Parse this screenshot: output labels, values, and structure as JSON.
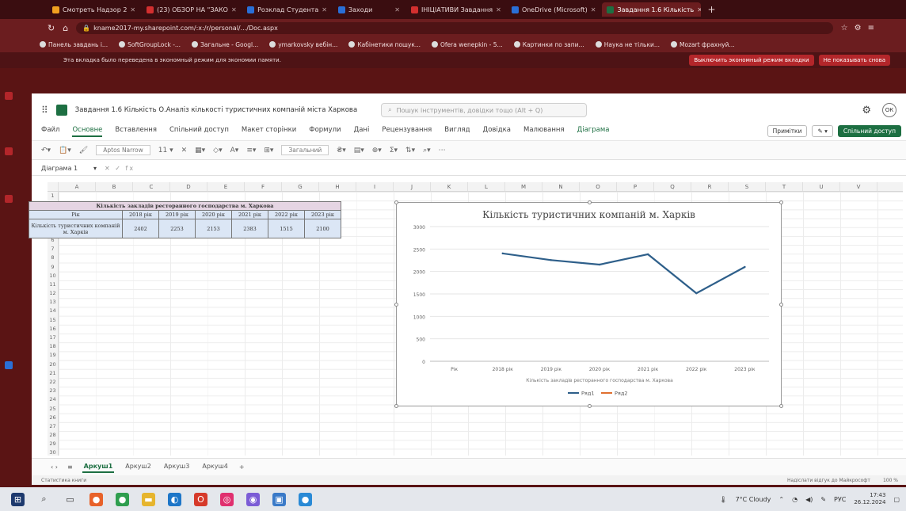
{
  "browser": {
    "tabs": [
      {
        "label": "Смотреть Надзор 2"
      },
      {
        "label": "(23) ОБЗОР НА \"ЗАКО"
      },
      {
        "label": "Розклад Студента"
      },
      {
        "label": "Заходи"
      },
      {
        "label": "ІНІЦІАТИВИ Завдання"
      },
      {
        "label": "OneDrive (Microsoft)"
      },
      {
        "label": "Завдання 1.6 Кількість",
        "active": true
      }
    ],
    "url": "kname2017-my.sharepoint.com/:x:/r/personal/.../Doc.aspx",
    "bookmarks": [
      "Панель завдань і...",
      "SoftGroupLock -...",
      "Загальне - Googl...",
      "ymarkovsky вебін...",
      "Кабінетики пошук...",
      "Ofera wenepkin - 5...",
      "Картинки по запи...",
      "Наука не тільки...",
      "Mozart фрахнуй..."
    ],
    "infobar": {
      "message": "Эта вкладка было переведена в экономный режим для экономии памяти.",
      "primary_button": "Выключить экономный режим вкладки",
      "secondary_button": "Не показывать снова"
    }
  },
  "excel": {
    "title": "Завдання 1.6 Кількість О.Аналіз кількості туристичних компаній міста Харкова",
    "search_placeholder": "Пошук інструментів, довідки тощо (Alt + Q)",
    "user_initials": "ОК",
    "menu": [
      "Файл",
      "Основне",
      "Вставлення",
      "Спільний доступ",
      "Макет сторінки",
      "Формули",
      "Дані",
      "Рецензування",
      "Вигляд",
      "Довідка",
      "Малювання",
      "Діаграма"
    ],
    "active_menu": "Основне",
    "accent_menu": "Діаграма",
    "comments_label": "Примітки",
    "share_label": "Спільний доступ",
    "font_name": "Aptos Narrow",
    "number_format": "Загальний",
    "namebox": "Діаграма 1",
    "columns": [
      "A",
      "B",
      "C",
      "D",
      "E",
      "F",
      "G",
      "H",
      "I",
      "J",
      "K",
      "L",
      "M",
      "N",
      "O",
      "P",
      "Q",
      "R",
      "S",
      "T",
      "U",
      "V"
    ],
    "rows": [
      "1",
      "2",
      "3",
      "4",
      "5",
      "6",
      "7",
      "8",
      "9",
      "10",
      "11",
      "12",
      "13",
      "14",
      "15",
      "16",
      "17",
      "18",
      "19",
      "20",
      "21",
      "22",
      "23",
      "24",
      "25",
      "26",
      "27",
      "28",
      "29",
      "30"
    ],
    "table": {
      "caption": "Кількість закладів ресторанного господарства м. Харкова",
      "row_header": "Рік",
      "years": [
        "2018 рік",
        "2019 рік",
        "2020 рік",
        "2021 рік",
        "2022 рік",
        "2023 рік"
      ],
      "row_label": "Кількість туристичних компаній м. Харків",
      "values": [
        "2402",
        "2253",
        "2153",
        "2383",
        "1515",
        "2100"
      ]
    },
    "sheets": [
      "Аркуш1",
      "Аркуш2",
      "Аркуш3",
      "Аркуш4"
    ],
    "active_sheet": "Аркуш1",
    "status_left": "Статистика книги",
    "status_right": "Надіслати відгук до Майкрософт",
    "zoom": "100 %"
  },
  "chart_data": {
    "type": "line",
    "title": "Кількість туристичних компаній м. Харків",
    "categories": [
      "Рік",
      "2018 рік",
      "2019 рік",
      "2020 рік",
      "2021 рік",
      "2022 рік",
      "2023 рік"
    ],
    "series": [
      {
        "name": "Ряд1",
        "color": "#2e5f8a",
        "values": [
          null,
          2402,
          2253,
          2153,
          2383,
          1515,
          2100
        ]
      },
      {
        "name": "Ряд2",
        "color": "#e07030",
        "values": [
          null,
          null,
          null,
          null,
          null,
          null,
          null
        ]
      }
    ],
    "xlabel": "Кількість закладів ресторанного господарства м. Харкова",
    "ylim": [
      0,
      3000
    ],
    "yticks": [
      0,
      500,
      1000,
      1500,
      2000,
      2500,
      3000
    ],
    "grid": true,
    "legend": "bottom"
  },
  "taskbar": {
    "weather": "7°C Cloudy",
    "lang": "РУС",
    "time": "17:43",
    "date": "26.12.2024"
  }
}
